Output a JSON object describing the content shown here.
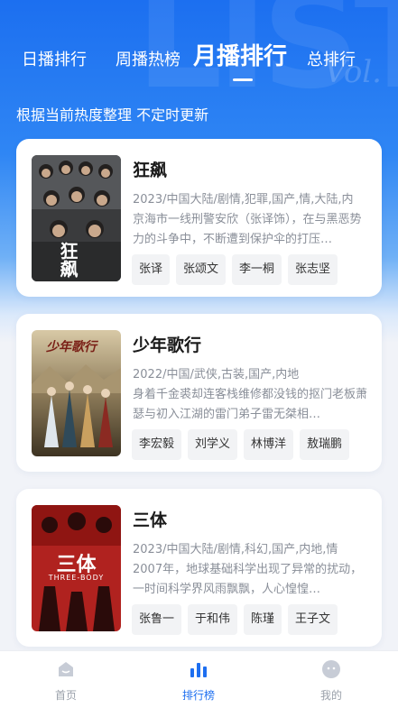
{
  "header": {
    "tabs": [
      {
        "label": "日播排行"
      },
      {
        "label": "周播热榜"
      },
      {
        "label": "月播排行",
        "active": true
      },
      {
        "label": "总排行"
      }
    ],
    "subtitle": "根据当前热度整理 不定时更新"
  },
  "shows": [
    {
      "title": "狂飙",
      "meta": "2023/中国大陆/剧情,犯罪,国产,情,大陆,内",
      "desc": "京海市一线刑警安欣（张译饰），在与黑恶势力的斗争中，不断遭到保护伞的打压…",
      "cast": [
        "张译",
        "张颂文",
        "李一桐",
        "张志坚"
      ],
      "poster_text": "狂飙",
      "poster_color": "#3a3b3d"
    },
    {
      "title": "少年歌行",
      "meta": "2022/中国/武侠,古装,国产,内地",
      "desc": "身着千金裘却连客栈维修都没钱的抠门老板萧瑟与初入江湖的雷门弟子雷无桀相…",
      "cast": [
        "李宏毅",
        "刘学义",
        "林博洋",
        "敖瑞鹏"
      ],
      "poster_text": "少年歌行",
      "poster_color": "#7a6a4e"
    },
    {
      "title": "三体",
      "meta": "2023/中国大陆/剧情,科幻,国产,内地,情",
      "desc": "2007年，地球基础科学出现了异常的扰动，一时间科学界风雨飘飘，人心惶惶…",
      "cast": [
        "张鲁一",
        "于和伟",
        "陈瑾",
        "王子文"
      ],
      "poster_text": "三体",
      "poster_subtext": "THREE-BODY",
      "poster_color": "#b0221f"
    }
  ],
  "bottom_nav": [
    {
      "label": "首页",
      "icon": "home-icon"
    },
    {
      "label": "排行榜",
      "icon": "chart-icon",
      "active": true
    },
    {
      "label": "我的",
      "icon": "profile-icon"
    }
  ],
  "colors": {
    "accent": "#1e6ff0",
    "hero": "#1c6ff0"
  }
}
